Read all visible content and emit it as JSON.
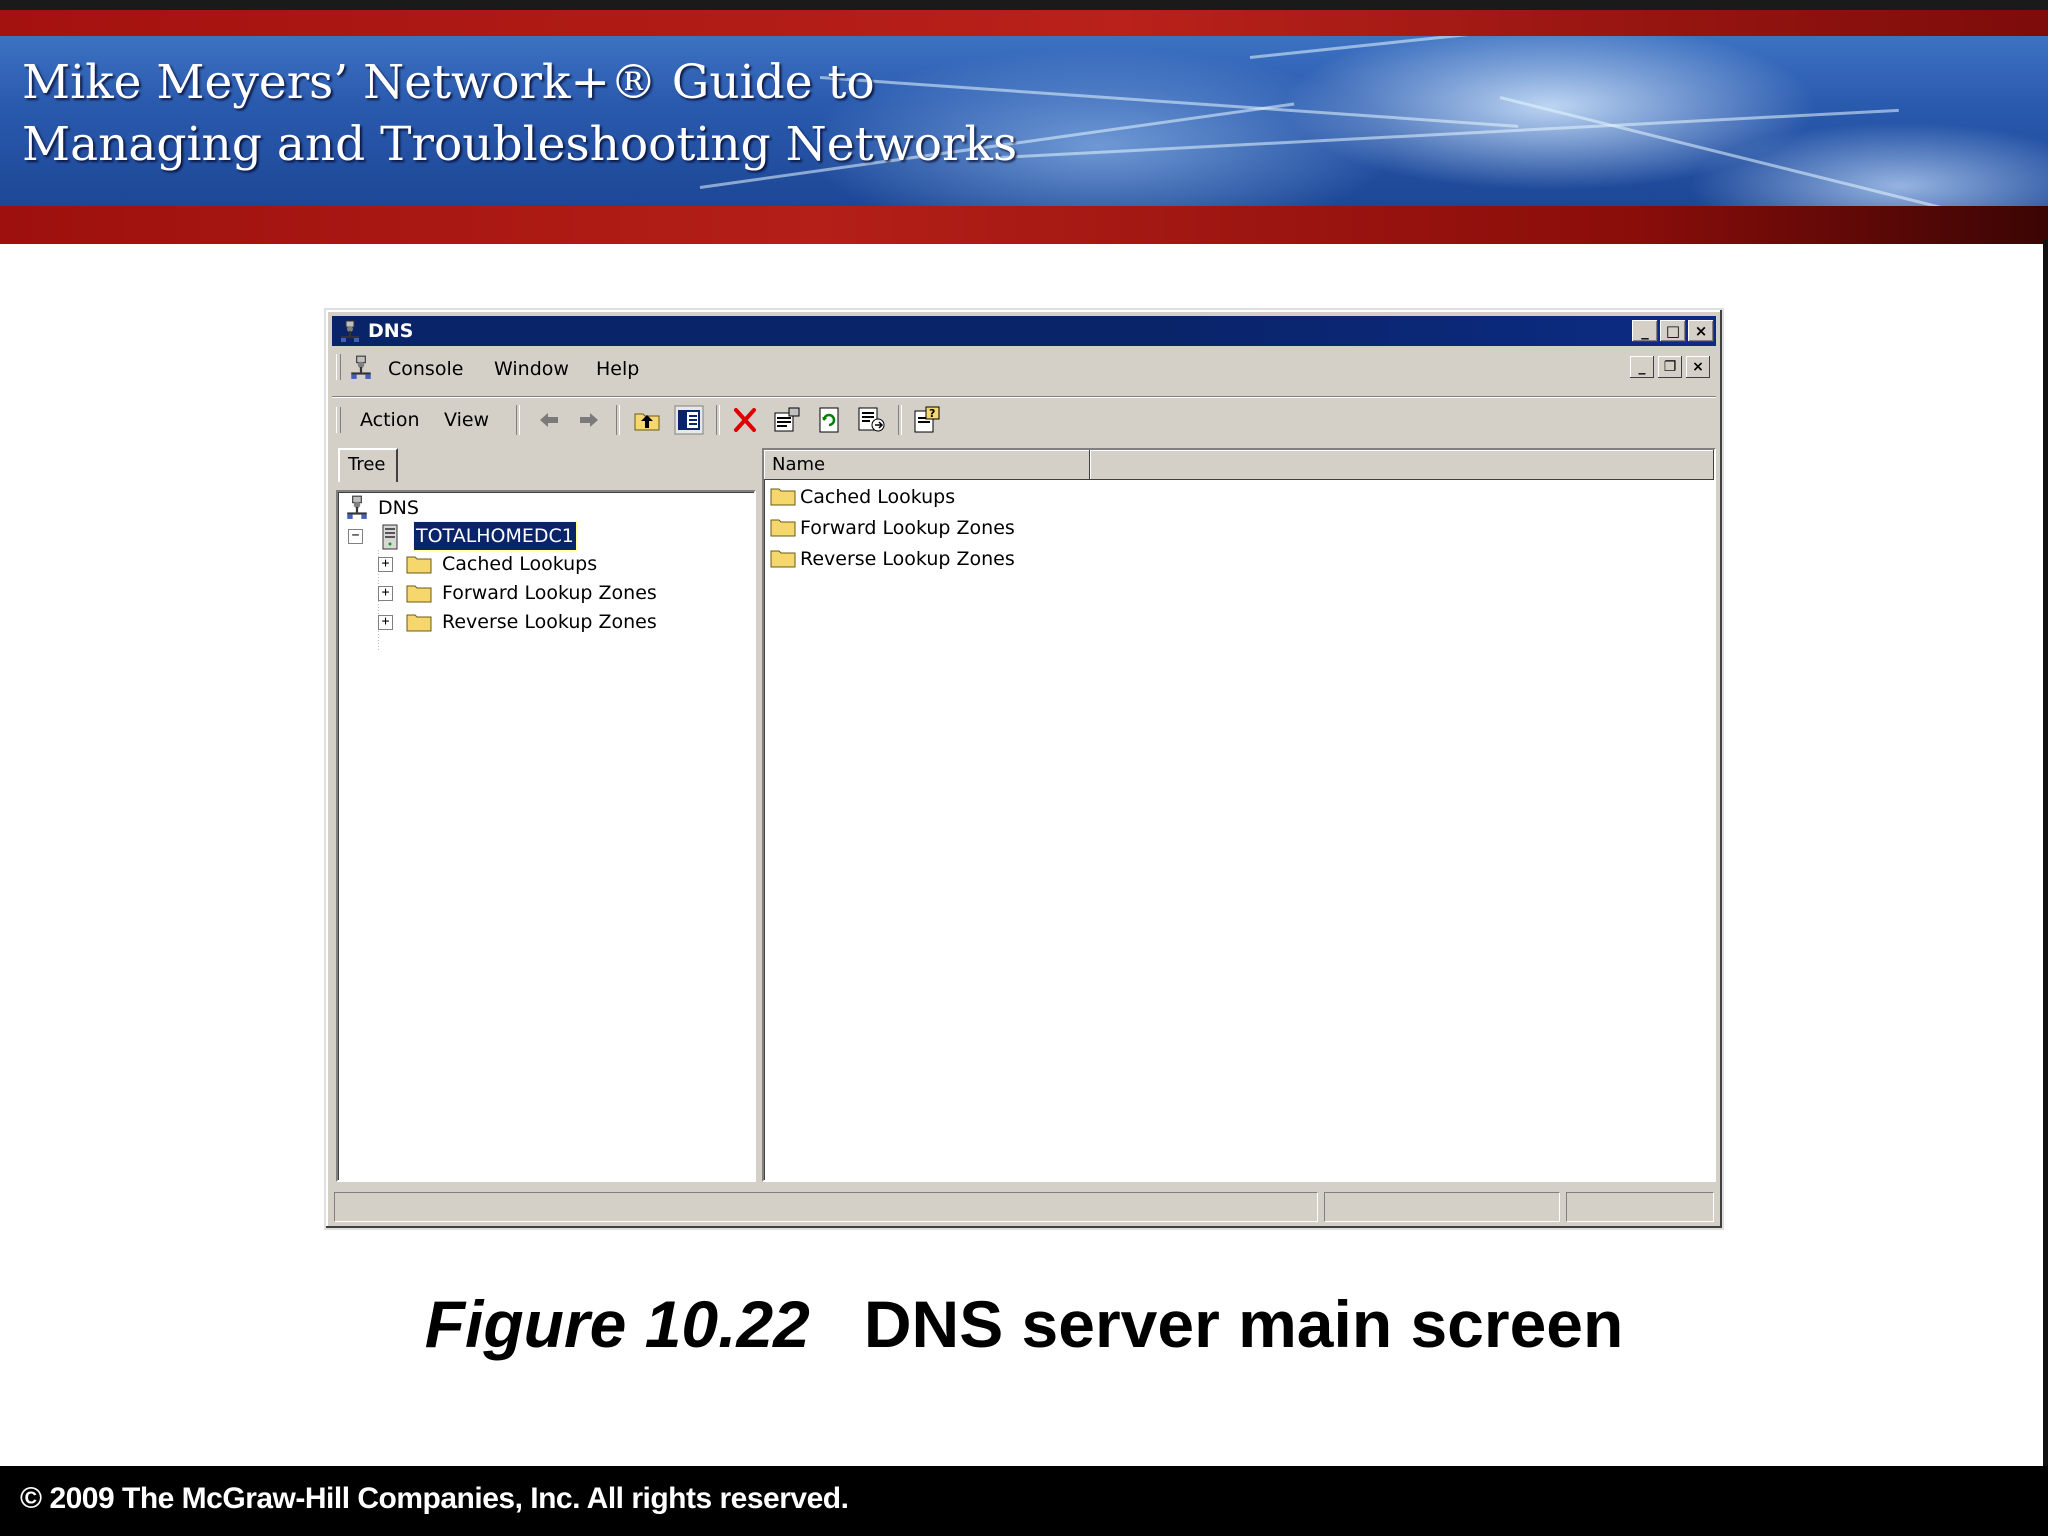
{
  "slide": {
    "title_line1": "Mike Meyers’ Network+® Guide to",
    "title_line2": "Managing and Troubleshooting Networks",
    "caption_figure": "Figure 10.22",
    "caption_text": "DNS server main screen",
    "footer": "© 2009 The McGraw-Hill Companies, Inc. All rights reserved."
  },
  "window": {
    "title": "DNS",
    "controls": {
      "minimize": "_",
      "maximize": "□",
      "close": "×"
    }
  },
  "menubar": {
    "items": [
      "Console",
      "Window",
      "Help"
    ],
    "mdi_controls": {
      "minimize": "_",
      "restore": "❐",
      "close": "×"
    }
  },
  "toolbar": {
    "menus": [
      "Action",
      "View"
    ],
    "buttons": [
      "back-icon",
      "forward-icon",
      "up-one-level-icon",
      "show-hide-tree-icon",
      "delete-icon",
      "properties-icon",
      "refresh-icon",
      "export-list-icon",
      "help-icon"
    ]
  },
  "tree": {
    "tab_label": "Tree",
    "root": "DNS",
    "server": "TOTALHOMEDC1",
    "children": [
      "Cached Lookups",
      "Forward Lookup Zones",
      "Reverse Lookup Zones"
    ]
  },
  "list": {
    "column_header": "Name",
    "items": [
      "Cached Lookups",
      "Forward Lookup Zones",
      "Reverse Lookup Zones"
    ]
  },
  "colors": {
    "titlebar": "#0a246a",
    "chrome": "#d4d0c8",
    "banner_red": "#b41f18",
    "banner_blue": "#2a5aae",
    "folder": "#f5d76e"
  }
}
